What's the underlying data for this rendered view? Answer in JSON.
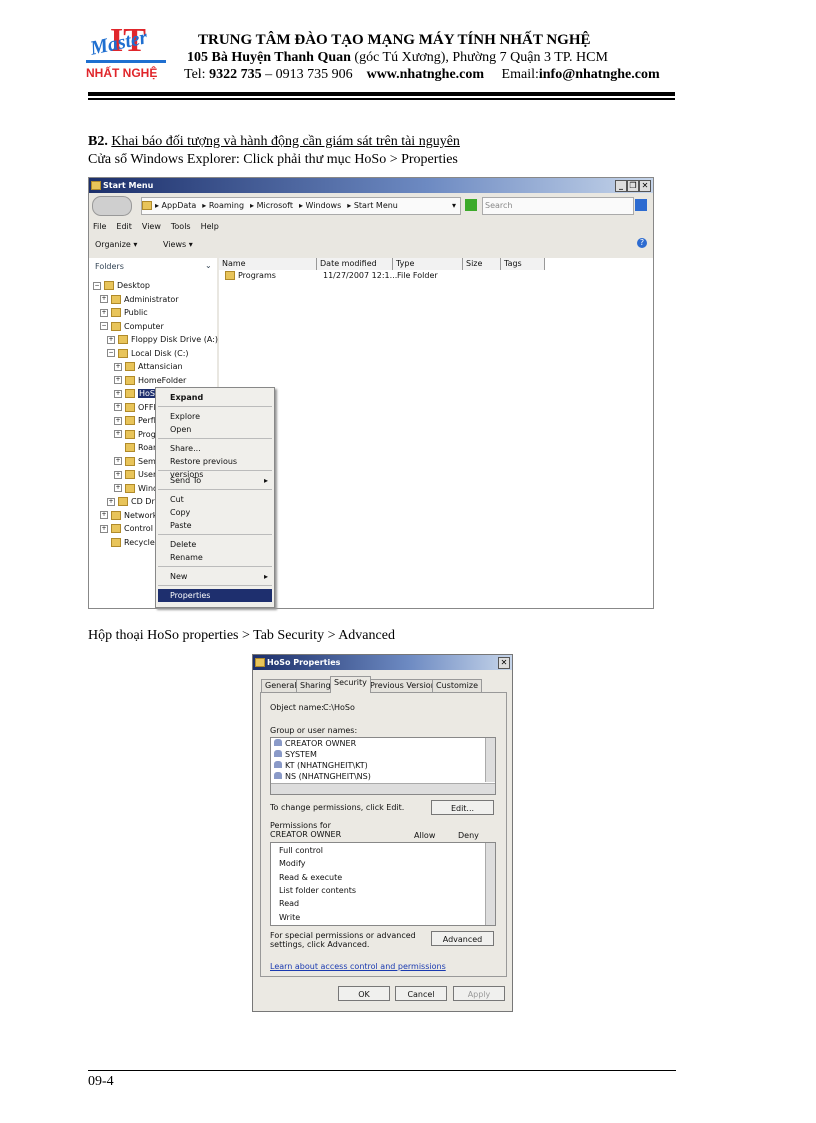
{
  "header": {
    "logo_text_top": "Master IT",
    "logo_text_bottom": "NHẤT NGHỆ",
    "org": "TRUNG TÂM ĐÀO TẠO MẠNG MÁY TÍNH NHẤT NGHỆ",
    "address_bold": "105 Bà Huyện Thanh Quan",
    "address_rest": " (góc Tú Xương), Phường 7 Quận 3  TP. HCM",
    "tel_label": "Tel: ",
    "tel_bold": "9322 735",
    "tel_rest": " – 0913 735 906",
    "website": "www.nhatnghe.com",
    "email_label": "Email:",
    "email": "info@nhatnghe.com"
  },
  "section": {
    "num": "B2.",
    "title": "Khai báo đối tượng và hành động cần giám sát trên tài nguyên",
    "instruction1": "Cửa sổ Windows Explorer: Click phải thư mục HoSo > Properties",
    "instruction2": "Hộp thoại HoSo properties > Tab Security > Advanced"
  },
  "explorer": {
    "title": "Start Menu",
    "breadcrumb": [
      "AppData",
      "Roaming",
      "Microsoft",
      "Windows",
      "Start Menu"
    ],
    "search_placeholder": "Search",
    "menu": [
      "File",
      "Edit",
      "View",
      "Tools",
      "Help"
    ],
    "organize": "Organize ▾",
    "views": "Views ▾",
    "folders_label": "Folders",
    "columns": [
      "Name",
      "Date modified",
      "Type",
      "Size",
      "Tags"
    ],
    "files": [
      {
        "name": "Programs",
        "date": "11/27/2007 12:1...",
        "type": "File Folder"
      }
    ],
    "tree": [
      {
        "label": "Desktop",
        "level": 0,
        "exp": "−"
      },
      {
        "label": "Administrator",
        "level": 1,
        "exp": "+"
      },
      {
        "label": "Public",
        "level": 1,
        "exp": "+"
      },
      {
        "label": "Computer",
        "level": 1,
        "exp": "−"
      },
      {
        "label": "Floppy Disk Drive (A:)",
        "level": 2,
        "exp": "+"
      },
      {
        "label": "Local Disk (C:)",
        "level": 2,
        "exp": "−"
      },
      {
        "label": "Attansician",
        "level": 3,
        "exp": "+"
      },
      {
        "label": "HomeFolder",
        "level": 3,
        "exp": "+"
      },
      {
        "label": "HoSo",
        "level": 3,
        "exp": "+",
        "selected": true
      },
      {
        "label": "OFFI",
        "level": 3,
        "exp": "+"
      },
      {
        "label": "PerfL",
        "level": 3,
        "exp": "+"
      },
      {
        "label": "Progr",
        "level": 3,
        "exp": "+"
      },
      {
        "label": "Roam",
        "level": 3,
        "exp": ""
      },
      {
        "label": "Semin",
        "level": 3,
        "exp": "+"
      },
      {
        "label": "Users",
        "level": 3,
        "exp": "+"
      },
      {
        "label": "Windo",
        "level": 3,
        "exp": "+"
      },
      {
        "label": "CD Driv",
        "level": 2,
        "exp": "+"
      },
      {
        "label": "Network",
        "level": 1,
        "exp": "+"
      },
      {
        "label": "Control P",
        "level": 1,
        "exp": "+"
      },
      {
        "label": "Recycle B",
        "level": 1,
        "exp": ""
      }
    ],
    "context_menu": [
      {
        "label": "Expand",
        "bold": true
      },
      {
        "sep": true
      },
      {
        "label": "Explore"
      },
      {
        "label": "Open"
      },
      {
        "sep": true
      },
      {
        "label": "Share..."
      },
      {
        "label": "Restore previous versions"
      },
      {
        "sep": true
      },
      {
        "label": "Send To",
        "sub": true
      },
      {
        "sep": true
      },
      {
        "label": "Cut"
      },
      {
        "label": "Copy"
      },
      {
        "label": "Paste"
      },
      {
        "sep": true
      },
      {
        "label": "Delete"
      },
      {
        "label": "Rename"
      },
      {
        "sep": true
      },
      {
        "label": "New",
        "sub": true
      },
      {
        "sep": true
      },
      {
        "label": "Properties",
        "highlight": true
      }
    ]
  },
  "dialog": {
    "title": "HoSo Properties",
    "tabs": [
      "General",
      "Sharing",
      "Security",
      "Previous Versions",
      "Customize"
    ],
    "active_tab": "Security",
    "object_label": "Object name:",
    "object_value": "C:\\HoSo",
    "group_label": "Group or user names:",
    "users": [
      "CREATOR OWNER",
      "SYSTEM",
      "KT (NHATNGHEIT\\KT)",
      "NS (NHATNGHEIT\\NS)"
    ],
    "change_text": "To change permissions, click Edit.",
    "edit": "Edit...",
    "perm_label": "Permissions for CREATOR OWNER",
    "allow": "Allow",
    "deny": "Deny",
    "permissions": [
      "Full control",
      "Modify",
      "Read & execute",
      "List folder contents",
      "Read",
      "Write"
    ],
    "special_text": "For special permissions or advanced settings, click Advanced.",
    "advanced": "Advanced",
    "learn_link": "Learn about access control and permissions",
    "ok": "OK",
    "cancel": "Cancel",
    "apply": "Apply"
  },
  "footer": {
    "page": "09-4"
  },
  "colors": {
    "titlebar": "#1c2f6a",
    "selection": "#1e2f6e",
    "link": "#1a3ab0"
  }
}
